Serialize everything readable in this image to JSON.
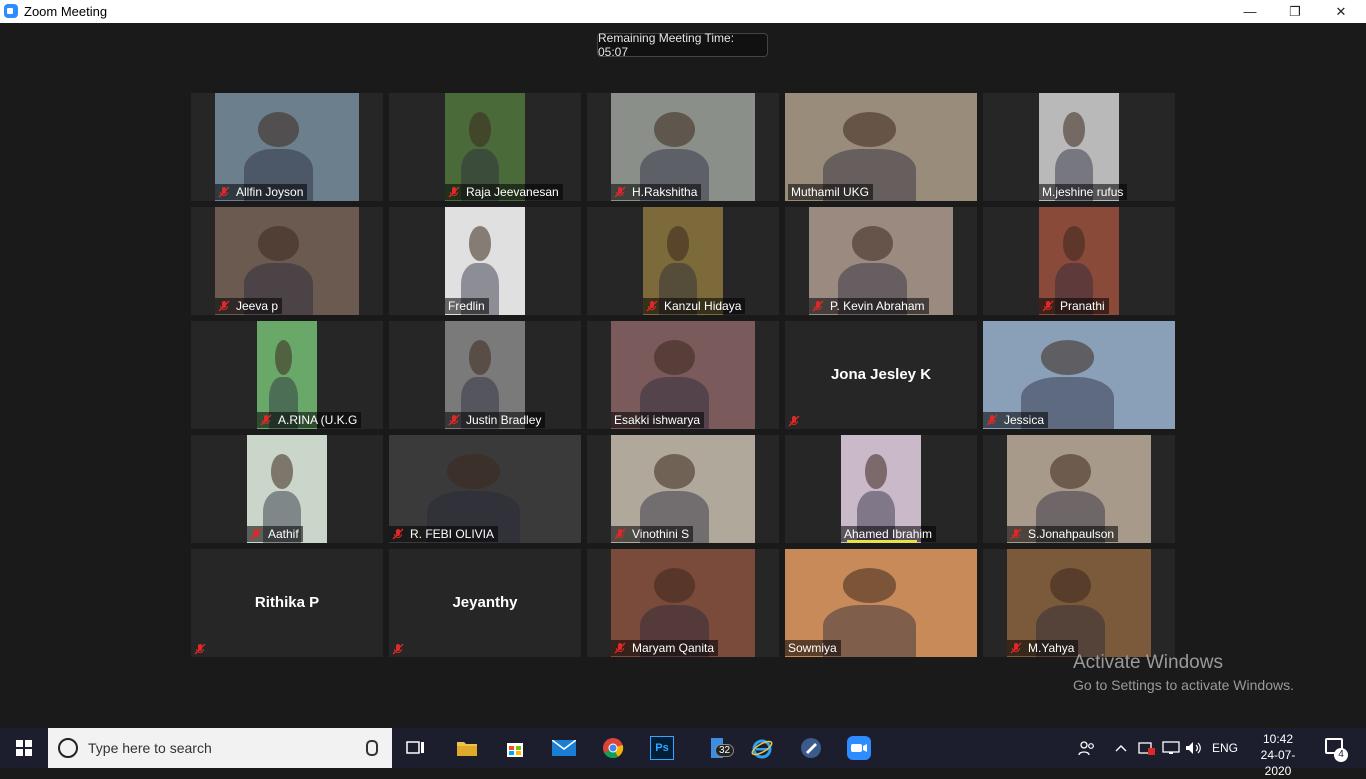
{
  "window": {
    "title": "Zoom Meeting",
    "minimize": "—",
    "restore": "❐",
    "close": "✕"
  },
  "meeting": {
    "remaining_time": "Remaining Meeting Time: 05:07"
  },
  "colors": {
    "active_speaker": "#d9e26c",
    "mute": "#e02828",
    "zoom_blue": "#2d8cff"
  },
  "participants": [
    {
      "name": "Allfin Joyson",
      "muted": true,
      "video": true
    },
    {
      "name": "Raja Jeevanesan",
      "muted": true,
      "video": true
    },
    {
      "name": "H.Rakshitha",
      "muted": true,
      "video": true
    },
    {
      "name": "Muthamil UKG",
      "muted": false,
      "video": true,
      "active": true
    },
    {
      "name": "M.jeshine rufus",
      "muted": false,
      "video": true
    },
    {
      "name": "Jeeva p",
      "muted": true,
      "video": true
    },
    {
      "name": "Fredlin",
      "muted": false,
      "video": true
    },
    {
      "name": "Kanzul Hidaya",
      "muted": true,
      "video": true
    },
    {
      "name": "P. Kevin Abraham",
      "muted": true,
      "video": true
    },
    {
      "name": "Pranathi",
      "muted": true,
      "video": true
    },
    {
      "name": "A.RINA (U.K.G",
      "muted": true,
      "video": true
    },
    {
      "name": "Justin Bradley",
      "muted": true,
      "video": true
    },
    {
      "name": "Esakki ishwarya",
      "muted": false,
      "video": true
    },
    {
      "name": "Jona Jesley K",
      "muted": true,
      "video": false
    },
    {
      "name": "Jessica",
      "muted": true,
      "video": true
    },
    {
      "name": "Aathif",
      "muted": true,
      "video": true
    },
    {
      "name": "R. FEBI OLIVIA",
      "muted": true,
      "video": true
    },
    {
      "name": "Vinothini S",
      "muted": true,
      "video": true
    },
    {
      "name": "Ahamed Ibrahim",
      "muted": false,
      "video": true,
      "speaking": true
    },
    {
      "name": "S.Jonahpaulson",
      "muted": true,
      "video": true
    },
    {
      "name": "Rithika P",
      "muted": true,
      "video": false
    },
    {
      "name": "Jeyanthy",
      "muted": true,
      "video": false
    },
    {
      "name": "Maryam Qanita",
      "muted": true,
      "video": true
    },
    {
      "name": "Sowmiya",
      "muted": false,
      "video": true
    },
    {
      "name": "M.Yahya",
      "muted": true,
      "video": true
    }
  ],
  "watermark": {
    "line1": "Activate Windows",
    "line2": "Go to Settings to activate Windows."
  },
  "taskbar": {
    "search_placeholder": "Type here to search",
    "apps": [
      "task-view",
      "file-explorer",
      "microsoft-store",
      "mail",
      "chrome",
      "photoshop",
      "multi-window",
      "internet-explorer",
      "app-launcher",
      "zoom"
    ],
    "photoshop_label": "Ps",
    "multiwindow_badge": "32",
    "language": "ENG",
    "time": "10:42",
    "date": "24-07-2020",
    "notifications": "4"
  }
}
